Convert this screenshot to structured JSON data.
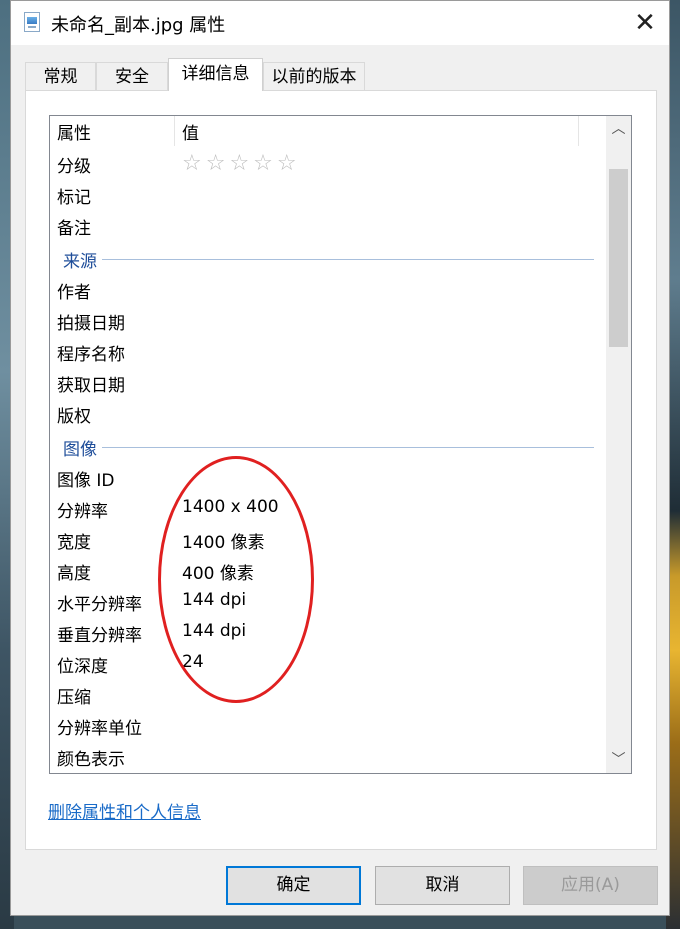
{
  "window": {
    "title": "未命名_副本.jpg 属性",
    "close_symbol": "✕"
  },
  "tabs": [
    {
      "label": "常规"
    },
    {
      "label": "安全"
    },
    {
      "label": "详细信息"
    },
    {
      "label": "以前的版本"
    }
  ],
  "list": {
    "header": {
      "property": "属性",
      "value": "值"
    },
    "rating": {
      "label": "分级",
      "stars": "☆☆☆☆☆",
      "value": 0,
      "max": 5
    },
    "rows_top": [
      {
        "prop": "标记",
        "val": ""
      },
      {
        "prop": "备注",
        "val": ""
      }
    ],
    "group_source": "来源",
    "rows_source": [
      {
        "prop": "作者",
        "val": ""
      },
      {
        "prop": "拍摄日期",
        "val": ""
      },
      {
        "prop": "程序名称",
        "val": ""
      },
      {
        "prop": "获取日期",
        "val": ""
      },
      {
        "prop": "版权",
        "val": ""
      }
    ],
    "group_image": "图像",
    "rows_image": [
      {
        "prop": "图像 ID",
        "val": ""
      },
      {
        "prop": "分辨率",
        "val": "1400 x 400"
      },
      {
        "prop": "宽度",
        "val": "1400 像素"
      },
      {
        "prop": "高度",
        "val": "400 像素"
      },
      {
        "prop": "水平分辨率",
        "val": "144 dpi"
      },
      {
        "prop": "垂直分辨率",
        "val": "144 dpi"
      },
      {
        "prop": "位深度",
        "val": "24"
      },
      {
        "prop": "压缩",
        "val": ""
      },
      {
        "prop": "分辨率单位",
        "val": ""
      },
      {
        "prop": "颜色表示",
        "val": ""
      }
    ],
    "scroll_up": "︿",
    "scroll_down": "﹀"
  },
  "remove_link": "删除属性和个人信息",
  "buttons": {
    "ok": "确定",
    "cancel": "取消",
    "apply": "应用(A)"
  },
  "colors": {
    "annotation": "#e02020",
    "link": "#1a6bc8",
    "group_label": "#1f4e9a",
    "primary_border": "#0078d7"
  }
}
